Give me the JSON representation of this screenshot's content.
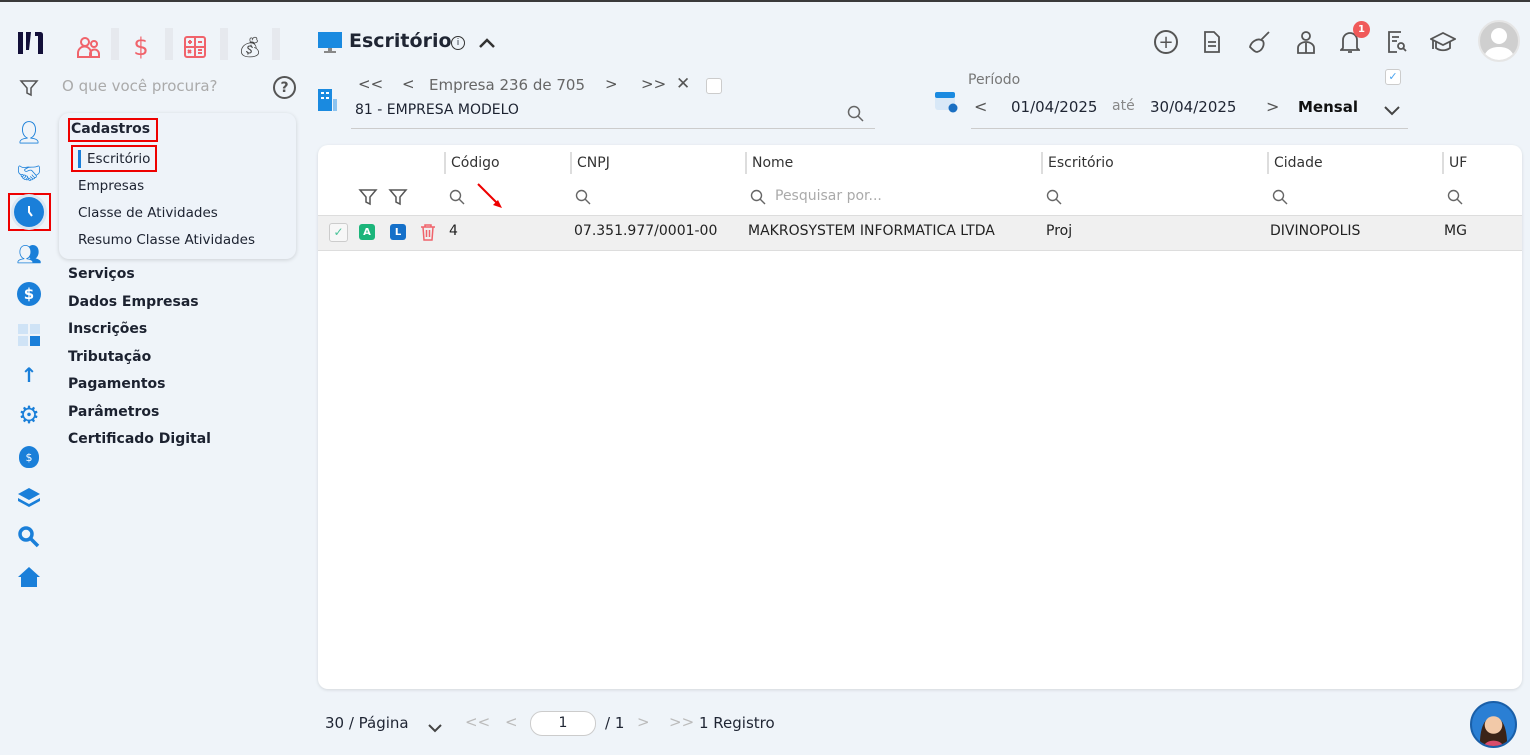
{
  "sidebar": {
    "search_placeholder": "O que você procura?",
    "top_apps": [
      "people-icon",
      "dollar-icon",
      "calculator-icon",
      "money-bag-icon"
    ],
    "rail_icons": [
      "user-gear-icon",
      "handshake-icon",
      "clock-icon",
      "users-icon",
      "dollar-circle-icon",
      "calculator-icon",
      "arrow-percent-icon",
      "gear-cross-icon",
      "money-bag-icon",
      "layers-icon",
      "magnifier-icon",
      "home-icon"
    ],
    "popup": {
      "title": "Cadastros",
      "items": [
        "Escritório",
        "Empresas",
        "Classe de Atividades",
        "Resumo Classe Atividades"
      ]
    },
    "sections": [
      "Serviços",
      "Dados Empresas",
      "Inscrições",
      "Tributação",
      "Pagamentos",
      "Parâmetros",
      "Certificado Digital"
    ]
  },
  "header": {
    "title": "Escritório",
    "notification_count": "1"
  },
  "company": {
    "nav_label": "Empresa 236 de 705",
    "selected": "81 - EMPRESA MODELO"
  },
  "period": {
    "label": "Período",
    "from": "01/04/2025",
    "sep": "até",
    "to": "30/04/2025",
    "mode": "Mensal"
  },
  "table": {
    "columns": [
      "Código",
      "CNPJ",
      "Nome",
      "Escritório",
      "Cidade",
      "UF"
    ],
    "search_placeholder": "Pesquisar por...",
    "badges": [
      "A",
      "L"
    ],
    "rows": [
      {
        "codigo": "4",
        "cnpj": "07.351.977/0001-00",
        "nome": "MAKROSYSTEM INFORMATICA LTDA",
        "escritorio": "Proj",
        "cidade": "DIVINOPOLIS",
        "uf": "MG"
      }
    ]
  },
  "pagination": {
    "per_page": "30 / Página",
    "page": "1",
    "total_pages": "/ 1",
    "records": "1 Registro"
  },
  "colors": {
    "accent": "#1a7fd9",
    "red": "#f0636b",
    "green": "#1bb57a"
  }
}
